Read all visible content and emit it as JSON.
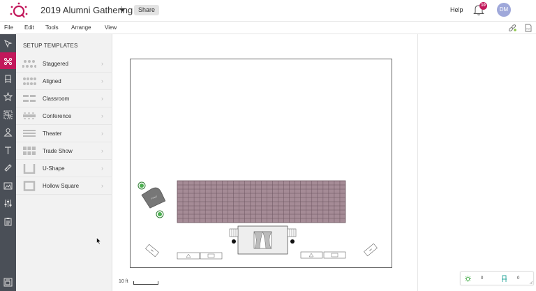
{
  "header": {
    "title": "2019 Alumni Gathering",
    "share_label": "Share",
    "help_label": "Help",
    "notification_count": "10",
    "avatar_initials": "DM"
  },
  "menu": {
    "items": [
      "File",
      "Edit",
      "Tools",
      "Arrange",
      "View"
    ]
  },
  "toolbar": {
    "tools": [
      "select-icon",
      "setup-templates-icon",
      "chair-icon",
      "star-icon",
      "group-icon",
      "person-icon",
      "text-icon",
      "ruler-icon",
      "image-icon",
      "settings-sliders-icon",
      "clipboard-icon",
      "floorplan-icon"
    ],
    "active": "setup-templates-icon"
  },
  "templates": {
    "title": "SETUP TEMPLATES",
    "items": [
      {
        "label": "Staggered",
        "icon": "staggered-icon"
      },
      {
        "label": "Aligned",
        "icon": "aligned-icon"
      },
      {
        "label": "Classroom",
        "icon": "classroom-icon"
      },
      {
        "label": "Conference",
        "icon": "conference-icon"
      },
      {
        "label": "Theater",
        "icon": "theater-icon"
      },
      {
        "label": "Trade Show",
        "icon": "trade-show-icon"
      },
      {
        "label": "U-Shape",
        "icon": "u-shape-icon"
      },
      {
        "label": "Hollow Square",
        "icon": "hollow-square-icon"
      }
    ]
  },
  "canvas": {
    "scale_label": "10 ft",
    "seating_grid": {
      "rows": 10,
      "cols": 30
    },
    "piano_label": "PIANO"
  },
  "counters": {
    "guests": "0",
    "seats": "0"
  },
  "colors": {
    "accent": "#c2185b",
    "toolbar_bg": "#4a4f57",
    "grid_fill": "#a58b96",
    "plant": "#2e7d32"
  }
}
